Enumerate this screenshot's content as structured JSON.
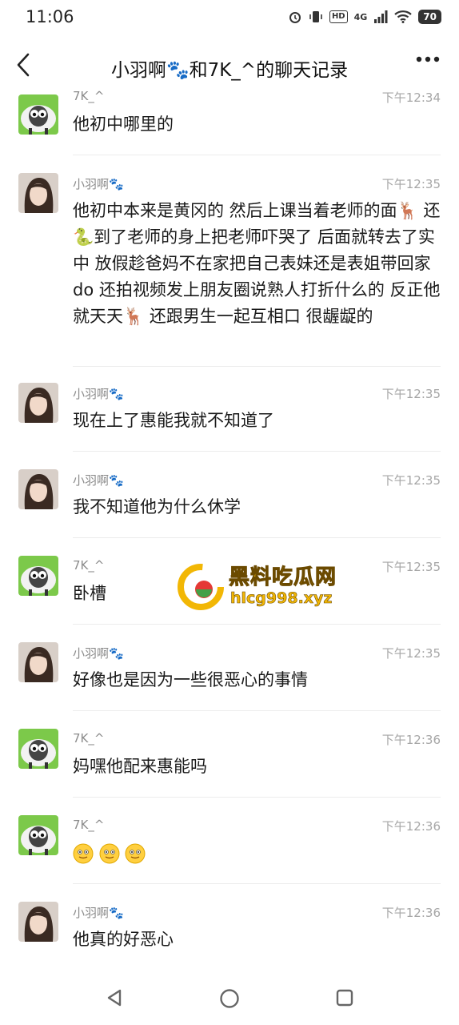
{
  "status": {
    "time": "11:06",
    "network": "4G",
    "battery": "70"
  },
  "header": {
    "title": "小羽啊🐾和7K_^的聊天记录",
    "back_icon": "chevron-left-icon",
    "more_icon": "more-dots-icon"
  },
  "messages": [
    {
      "sender": "7K_^",
      "time": "下午12:34",
      "text": "他初中哪里的",
      "avatar": "sheep"
    },
    {
      "sender": "小羽啊🐾",
      "time": "下午12:35",
      "text": "他初中本来是黄冈的 然后上课当着老师的面🦌 还🐍到了老师的身上把老师吓哭了 后面就转去了实中 放假趁爸妈不在家把自己表妹还是表姐带回家do 还拍视频发上朋友圈说熟人打折什么的 反正他就天天🦌 还跟男生一起互相口 很龌龊的",
      "avatar": "girl"
    },
    {
      "sender": "小羽啊🐾",
      "time": "下午12:35",
      "text": "现在上了惠能我就不知道了",
      "avatar": "girl"
    },
    {
      "sender": "小羽啊🐾",
      "time": "下午12:35",
      "text": "我不知道他为什么休学",
      "avatar": "girl"
    },
    {
      "sender": "7K_^",
      "time": "下午12:35",
      "text": "卧槽",
      "avatar": "sheep"
    },
    {
      "sender": "小羽啊🐾",
      "time": "下午12:35",
      "text": "好像也是因为一些很恶心的事情",
      "avatar": "girl"
    },
    {
      "sender": "7K_^",
      "time": "下午12:36",
      "text": "妈嘿他配来惠能吗",
      "avatar": "sheep"
    },
    {
      "sender": "7K_^",
      "time": "下午12:36",
      "text": "",
      "emoji_count": 3,
      "avatar": "sheep"
    },
    {
      "sender": "小羽啊🐾",
      "time": "下午12:36",
      "text": "他真的好恶心",
      "avatar": "girl"
    }
  ],
  "watermark": {
    "line1": "黑料吃瓜网",
    "line2": "hlcg998.xyz"
  },
  "nav": {
    "back": "nav-back-icon",
    "home": "nav-home-icon",
    "recents": "nav-recents-icon"
  }
}
